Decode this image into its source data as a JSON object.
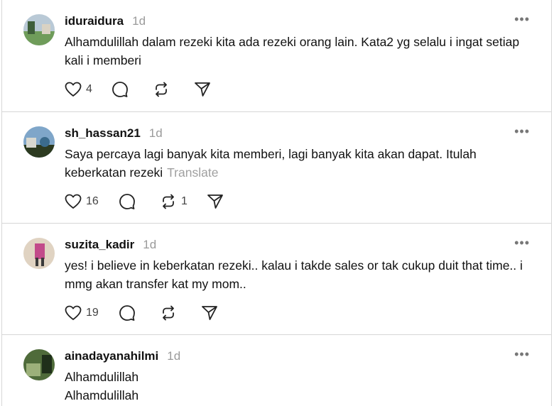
{
  "posts": [
    {
      "username": "iduraidura",
      "time": "1d",
      "text": "Alhamdulillah dalam rezeki kita ada rezeki orang lain. Kata2 yg selalu i ingat setiap kali i memberi",
      "translate": "",
      "likes": "4",
      "comments": "",
      "reposts": "",
      "avatar_colors": [
        "#6f9c5a",
        "#b9c9d6",
        "#3e5e3a"
      ]
    },
    {
      "username": "sh_hassan21",
      "time": "1d",
      "text": "Saya percaya lagi banyak kita memberi, lagi banyak kita akan dapat. Itulah keberkatan rezeki",
      "translate": "Translate",
      "likes": "16",
      "comments": "",
      "reposts": "1",
      "avatar_colors": [
        "#7fa6c9",
        "#3b6b8c",
        "#2c3a20"
      ]
    },
    {
      "username": "suzita_kadir",
      "time": "1d",
      "text": "yes! i believe in keberkatan rezeki.. kalau i takde sales or tak cukup duit that time.. i mmg akan transfer kat my mom..",
      "translate": "",
      "likes": "19",
      "comments": "",
      "reposts": "",
      "avatar_colors": [
        "#e0d3c2",
        "#c24a8a",
        "#3a3a3a"
      ]
    },
    {
      "username": "ainadayanahilmi",
      "time": "1d",
      "text_lines": [
        "Alhamdulillah",
        "Alhamdulillah"
      ],
      "avatar_colors": [
        "#4f6b3a",
        "#9cb07a",
        "#1f2f1a"
      ]
    }
  ],
  "icons": {
    "more": "more-horizontal-icon",
    "like": "heart-icon",
    "comment": "comment-icon",
    "repost": "repost-icon",
    "share": "send-icon"
  },
  "colors": {
    "text": "#111111",
    "muted": "#9a9a9a",
    "divider": "#d6d6d6"
  }
}
